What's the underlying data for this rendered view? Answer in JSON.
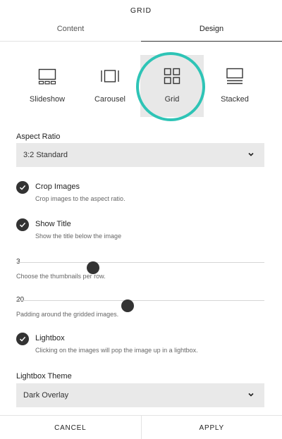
{
  "panel": {
    "title": "GRID"
  },
  "tabs": [
    {
      "label": "Content",
      "active": false
    },
    {
      "label": "Design",
      "active": true
    }
  ],
  "layouts": [
    {
      "label": "Slideshow",
      "icon": "slideshow-icon",
      "selected": false
    },
    {
      "label": "Carousel",
      "icon": "carousel-icon",
      "selected": false
    },
    {
      "label": "Grid",
      "icon": "grid-icon",
      "selected": true
    },
    {
      "label": "Stacked",
      "icon": "stacked-icon",
      "selected": false
    }
  ],
  "highlight_color": "#2ec4b6",
  "aspect_ratio": {
    "label": "Aspect Ratio",
    "value": "3:2 Standard",
    "icon": "chevron-down-icon"
  },
  "crop_images": {
    "title": "Crop Images",
    "description": "Crop images to the aspect ratio.",
    "checked": true
  },
  "show_title": {
    "title": "Show Title",
    "description": "Show the title below the image",
    "checked": true
  },
  "thumbnails_per_row": {
    "value": "3",
    "description": "Choose the thumbnails per row.",
    "level": 0.31
  },
  "padding": {
    "value": "20",
    "description": "Padding around the gridded images.",
    "level": 0.45
  },
  "lightbox": {
    "title": "Lightbox",
    "description": "Clicking on the images will pop the image up in a lightbox.",
    "checked": true
  },
  "lightbox_theme": {
    "label": "Lightbox Theme",
    "value": "Dark Overlay",
    "icon": "chevron-down-icon"
  },
  "footer": {
    "cancel_label": "CANCEL",
    "apply_label": "APPLY"
  }
}
